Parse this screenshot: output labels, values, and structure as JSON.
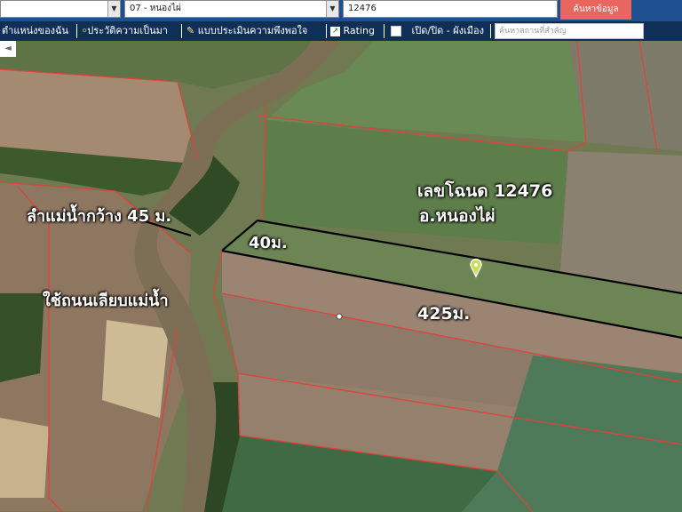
{
  "toolbar": {
    "province_value": "",
    "amphoe_value": "07 - หนองไผ่",
    "deed_value": "12476",
    "search_button": "ค้นหาข้อมูล"
  },
  "menu": {
    "item_location": "ตำแหน่งของฉัน",
    "item_history": "ประวัติความเป็นมา",
    "item_survey": "แบบประเมินความพึงพอใจ",
    "item_rating": "Rating",
    "item_toggle": "เปิด/ปิด - ผังเมือง",
    "place_search_placeholder": "ค้นหาสถานที่สำคัญ"
  },
  "map": {
    "deed_label": "เลขโฉนด 12476",
    "district_label": "อ.หนองไผ่",
    "river_label": "ลำแม่น้ำกว้าง 45 ม.",
    "road_label": "ใช้ถนนเลียบแม่น้ำ",
    "width_label": "40ม.",
    "length_label": "425ม."
  },
  "colors": {
    "toolbar": "#1e4f8f",
    "menubar": "#0f2f57",
    "search_button": "#e8665f",
    "parcel_line": "#e0413a"
  }
}
